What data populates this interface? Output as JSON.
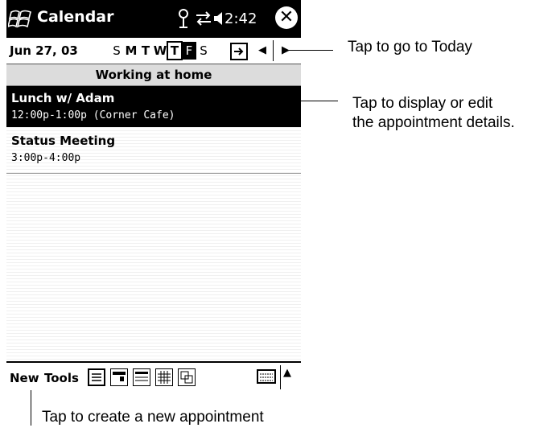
{
  "titlebar": {
    "app_title": "Calendar",
    "time": "2:42",
    "icons": [
      "windows-start-icon",
      "antenna-icon",
      "connectivity-icon",
      "speaker-icon",
      "close-icon"
    ],
    "close_glyph": "✕"
  },
  "navigation": {
    "date": "Jun 27, 03",
    "weekdays": [
      "S",
      "M",
      "T",
      "W",
      "T",
      "F",
      "S"
    ],
    "today_index": 4,
    "selected_index": 5,
    "prev_glyph": "◀",
    "next_glyph": "▶"
  },
  "banner": "Working at home",
  "appointments": [
    {
      "title": "Lunch w/ Adam",
      "time": "12:00p-1:00p (Corner Cafe)",
      "selected": true
    },
    {
      "title": "Status Meeting",
      "time": "3:00p-4:00p",
      "selected": false
    }
  ],
  "command_bar": {
    "new_label": "New",
    "tools_label": "Tools",
    "views": [
      "agenda-view-icon",
      "day-view-icon",
      "week-view-icon",
      "month-view-icon",
      "year-view-icon"
    ],
    "sip_glyph": "▲"
  },
  "callouts": {
    "today": "Tap to go to Today",
    "details_line1": "Tap to display or edit",
    "details_line2": "the appointment details.",
    "new_appt": "Tap to create a new appointment"
  },
  "colors": {
    "titlebar_bg": "#000000",
    "banner_bg": "#dcdcdc",
    "selection_bg": "#000000"
  }
}
